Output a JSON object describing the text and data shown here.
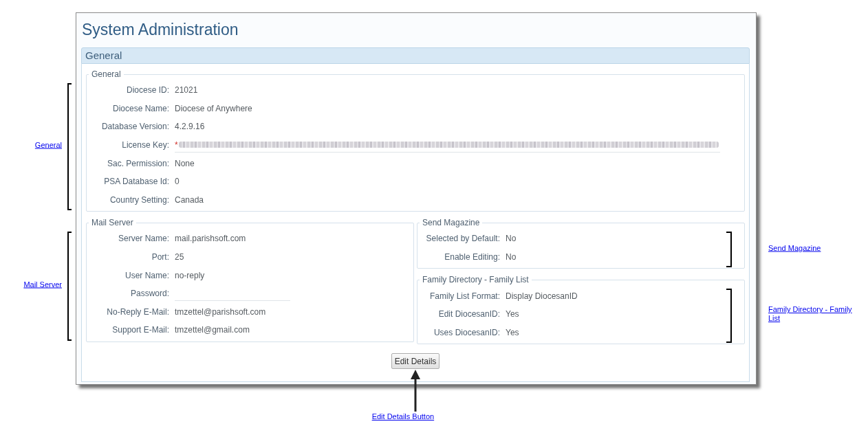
{
  "window": {
    "title": "System Administration"
  },
  "panel": {
    "title": "General",
    "sections": [
      {
        "legend": "General",
        "annotation": {
          "label": "General",
          "kind": "left-bracket"
        },
        "fields": [
          {
            "kind": "text",
            "label": "Diocese ID:",
            "value": "21021"
          },
          {
            "kind": "text",
            "label": "Diocese Name:",
            "value": "Diocese of Anywhere"
          },
          {
            "kind": "text",
            "label": "Database Version:",
            "value": "4.2.9.16"
          },
          {
            "kind": "input",
            "label": "License Key:",
            "required_marker": "*",
            "redacted": true
          },
          {
            "kind": "text",
            "label": "Sac. Permission:",
            "value": "None"
          },
          {
            "kind": "text",
            "label": "PSA Database Id:",
            "value": "0"
          },
          {
            "kind": "text",
            "label": "Country Setting:",
            "value": "Canada"
          }
        ]
      },
      {
        "legend": "Mail Server",
        "annotation": {
          "label": "Mail Server",
          "kind": "left-bracket"
        },
        "fields": [
          {
            "kind": "text",
            "label": "Server Name:",
            "value": "mail.parishsoft.com"
          },
          {
            "kind": "text",
            "label": "Port:",
            "value": "25"
          },
          {
            "kind": "text",
            "label": "User Name:",
            "value": "no-reply"
          },
          {
            "kind": "input",
            "label": "Password:"
          },
          {
            "kind": "text",
            "label": "No-Reply E-Mail:",
            "value": "tmzettel@parishsoft.com"
          },
          {
            "kind": "text",
            "label": "Support E-Mail:",
            "value": "tmzettel@gmail.com"
          }
        ]
      },
      {
        "legend": "Send Magazine",
        "annotation": {
          "label": "Send Magazine",
          "kind": "right-bracket"
        },
        "fields": [
          {
            "kind": "text",
            "label": "Selected by Default:",
            "value": "No"
          },
          {
            "kind": "text",
            "label": "Enable Editing:",
            "value": "No"
          }
        ]
      },
      {
        "legend": "Family Directory - Family List",
        "annotation": {
          "label": "Family Directory - Family List",
          "kind": "right-bracket"
        },
        "fields": [
          {
            "kind": "text",
            "label": "Family List Format:",
            "value": "Display DiocesanID"
          },
          {
            "kind": "text",
            "label": "Edit DiocesanID:",
            "value": "Yes"
          },
          {
            "kind": "text",
            "label": "Uses DiocesanID:",
            "value": "Yes"
          }
        ]
      }
    ],
    "buttons": [
      {
        "label": "Edit Details",
        "annotation": {
          "label": "Edit Details Button",
          "kind": "arrow"
        }
      }
    ]
  }
}
